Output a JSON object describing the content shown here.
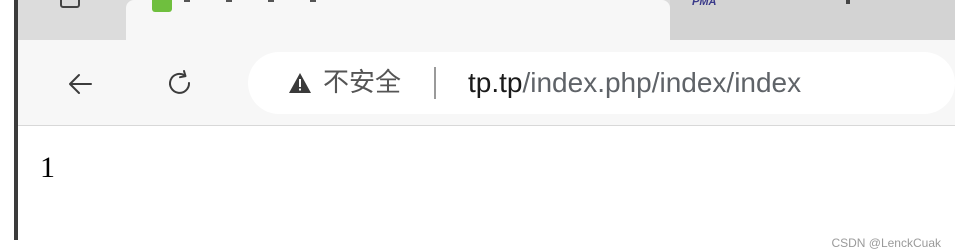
{
  "tabs": [
    {
      "label": "",
      "active": false
    },
    {
      "label": "",
      "active": true
    },
    {
      "label": "PMA",
      "active": false
    }
  ],
  "toolbar": {
    "back_icon": "arrow-left-icon",
    "reload_icon": "reload-icon"
  },
  "address_bar": {
    "security_icon": "warning-triangle-icon",
    "security_label": "不安全",
    "url_host": "tp.tp",
    "url_path": "/index.php/index/index"
  },
  "page": {
    "body_text": "1"
  },
  "watermark": "CSDN @LenckCuak",
  "colors": {
    "toolbar_bg": "#f7f7f7",
    "tabstrip_bg": "#dcdcdc",
    "host_text": "#1a1a1a",
    "path_text": "#5f6368"
  }
}
